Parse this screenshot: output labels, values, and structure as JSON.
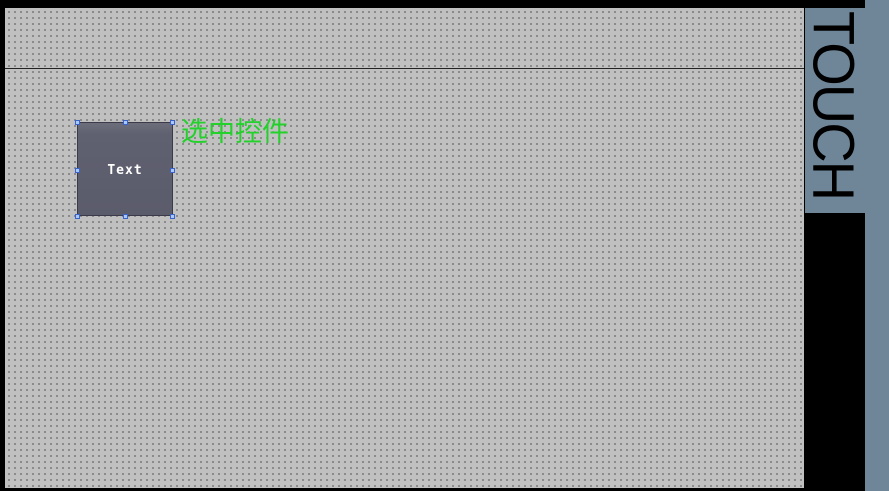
{
  "widget": {
    "label": "Text"
  },
  "annotation": {
    "selected_text": "选中控件"
  },
  "brand": {
    "touch_text": "TOUCH"
  },
  "colors": {
    "canvas": "#c0c0c0",
    "widget_bg": "#5b5c6b",
    "annotation": "#22d12a",
    "touch_panel": "#6e8698",
    "frame": "#000000"
  }
}
